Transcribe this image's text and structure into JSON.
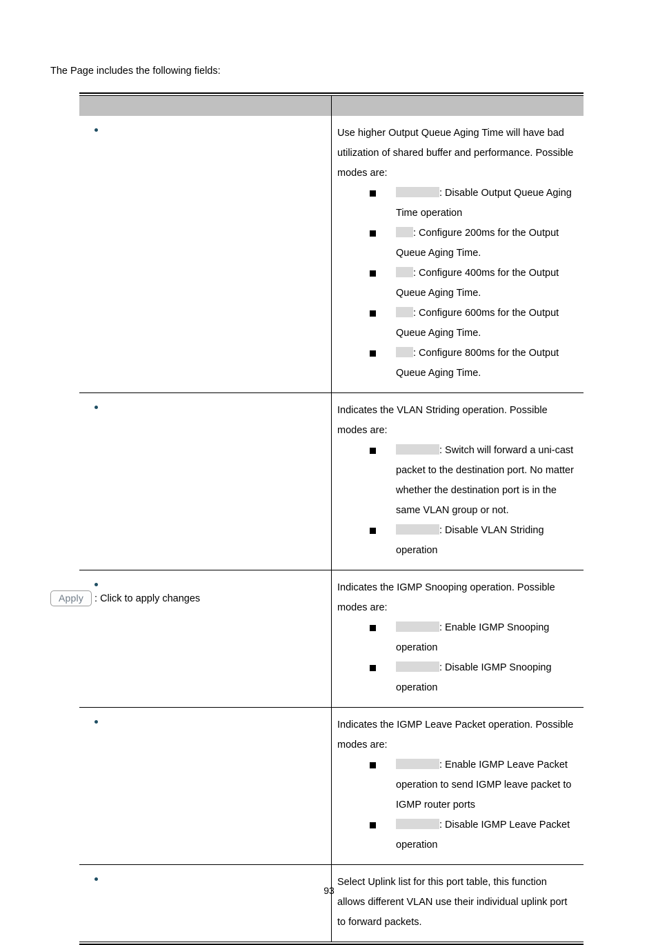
{
  "document": {
    "intro_text": "The Page includes the following fields:",
    "page_number": "93"
  },
  "table": {
    "header": {
      "col1": "",
      "col2": ""
    },
    "rows": [
      {
        "label": "",
        "description": "Use higher Output Queue Aging Time will have bad utilization of shared buffer and performance. Possible modes are:",
        "modes": [
          {
            "chip": "wide",
            "text": ": Disable Output Queue Aging Time operation"
          },
          {
            "chip": "narrow",
            "text": ": Configure 200ms for the Output Queue Aging Time."
          },
          {
            "chip": "narrow",
            "text": ": Configure 400ms for the Output Queue Aging Time."
          },
          {
            "chip": "narrow",
            "text": ": Configure 600ms for the Output Queue Aging Time."
          },
          {
            "chip": "narrow",
            "text": ": Configure 800ms for the Output Queue Aging Time."
          }
        ]
      },
      {
        "label": "",
        "description": "Indicates the VLAN Striding operation. Possible modes are:",
        "modes": [
          {
            "chip": "wide",
            "text": ": Switch will forward a uni-cast packet to the destination port. No matter whether the destination port is in the same VLAN group or not."
          },
          {
            "chip": "wide",
            "text": ": Disable VLAN Striding operation"
          }
        ]
      },
      {
        "label": "",
        "description": "Indicates the IGMP Snooping operation. Possible modes are:",
        "modes": [
          {
            "chip": "wide",
            "text": ": Enable IGMP Snooping operation"
          },
          {
            "chip": "wide",
            "text": ": Disable IGMP Snooping operation"
          }
        ]
      },
      {
        "label": "",
        "description": "Indicates the IGMP Leave Packet operation. Possible modes are:",
        "modes": [
          {
            "chip": "wide",
            "text": ": Enable IGMP Leave Packet operation to send IGMP leave packet to IGMP router ports"
          },
          {
            "chip": "wide",
            "text": ": Disable IGMP Leave Packet operation"
          }
        ]
      },
      {
        "label": "",
        "description": "Select Uplink list for this port table, this function allows different VLAN use their individual uplink port to forward packets.",
        "modes": []
      }
    ]
  },
  "legend": {
    "apply_button_label": "Apply",
    "apply_caption": ": Click to apply changes"
  },
  "colors": {
    "header_fill": "#c0c0c0",
    "chip_fill": "#d9d9d9",
    "bullet_navy": "#1f4e63",
    "apply_text": "#6e7a86"
  }
}
